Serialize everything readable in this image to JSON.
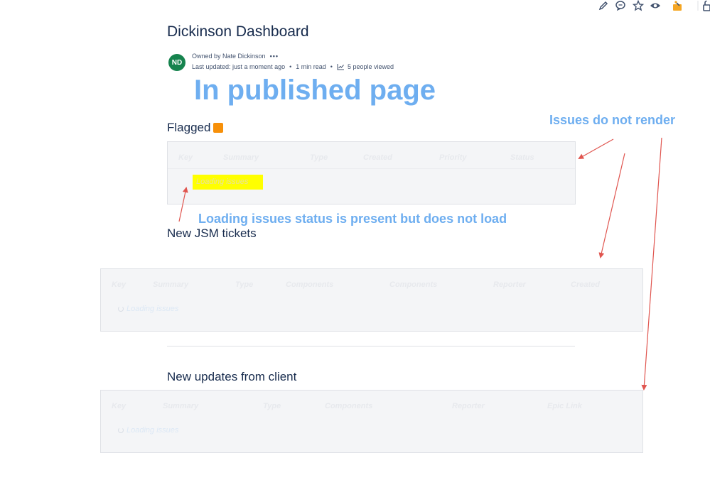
{
  "toolbar": {
    "icons": [
      "pencil-icon",
      "comment-icon",
      "star-icon",
      "eye-icon",
      "app-icon",
      "unlock-icon"
    ]
  },
  "page": {
    "title": "Dickinson Dashboard",
    "avatar_initials": "ND",
    "owned_by": "Owned by Nate Dickinson",
    "more": "•••",
    "last_updated": "Last updated: just a moment ago",
    "read_time": "1 min read",
    "views": "5 people viewed"
  },
  "annotations": {
    "published": "In published page",
    "issues_not_render": "Issues do not render",
    "loading_status": "Loading issues status is present but does not load"
  },
  "sections": {
    "flagged": {
      "heading": "Flagged",
      "columns": [
        "Key",
        "Summary",
        "Type",
        "Created",
        "Priority",
        "Status"
      ],
      "loading": "Loading issues"
    },
    "jsm": {
      "heading": "New JSM tickets",
      "columns": [
        "Key",
        "Summary",
        "Type",
        "Components",
        "Components",
        "Reporter",
        "Created"
      ],
      "loading": "Loading issues"
    },
    "client": {
      "heading": "New updates from client",
      "columns": [
        "Key",
        "Summary",
        "Type",
        "Components",
        "Reporter",
        "Epic Link"
      ],
      "loading": "Loading issues"
    }
  },
  "colors": {
    "annotation": "#6eaef0",
    "arrow": "#e0554f",
    "flag": "#f79009",
    "highlight": "#ffff00",
    "avatar": "#16834e"
  }
}
